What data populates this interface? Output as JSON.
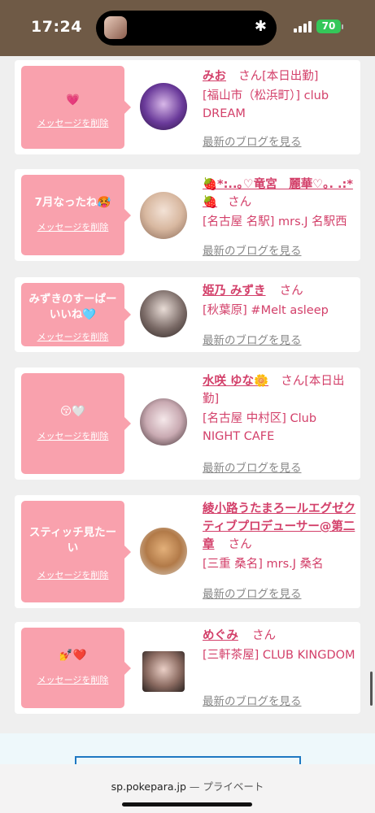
{
  "status_bar": {
    "time": "17:24",
    "battery": "70"
  },
  "cards": [
    {
      "message": "💗",
      "delete_label": "メッセージを削除",
      "name": "みお",
      "honorific": "さん",
      "tag": "[本日出勤]",
      "shop": "[福山市（松浜町）] club DREAM",
      "blog_label": "最新のブログを見る"
    },
    {
      "message": "7月なったね🥵",
      "delete_label": "メッセージを削除",
      "name": "🍓*:..｡♡竜宮　麗華♡｡. .:*🍓",
      "honorific": "さん",
      "tag": "",
      "shop": "[名古屋 名駅] mrs.J 名駅西",
      "blog_label": "最新のブログを見る"
    },
    {
      "message": "みずきのすーぱーいいね🩵",
      "delete_label": "メッセージを削除",
      "name": "姫乃 みずき",
      "honorific": "さん",
      "tag": "",
      "shop": "[秋葉原] #Melt asleep",
      "blog_label": "最新のブログを見る"
    },
    {
      "message": "😚🤍",
      "delete_label": "メッセージを削除",
      "name": "水咲 ゆな🌼",
      "honorific": "さん",
      "tag": "[本日出勤]",
      "shop": "[名古屋 中村区] Club NIGHT CAFE",
      "blog_label": "最新のブログを見る"
    },
    {
      "message": "スティッチ見たーい",
      "delete_label": "メッセージを削除",
      "name": "綾小路うたまろールエグゼクティブプロデューサー@第二章",
      "honorific": "さん",
      "tag": "",
      "shop": "[三重 桑名] mrs.J 桑名",
      "blog_label": "最新のブログを見る"
    },
    {
      "message": "💅❤️",
      "delete_label": "メッセージを削除",
      "name": "めぐみ",
      "honorific": "さん",
      "tag": "",
      "shop": "[三軒茶屋] CLUB KINGDOM",
      "blog_label": "最新のブログを見る"
    }
  ],
  "browser": {
    "domain": "sp.pokepara.jp",
    "separator": " — ",
    "mode": "プライベート"
  }
}
